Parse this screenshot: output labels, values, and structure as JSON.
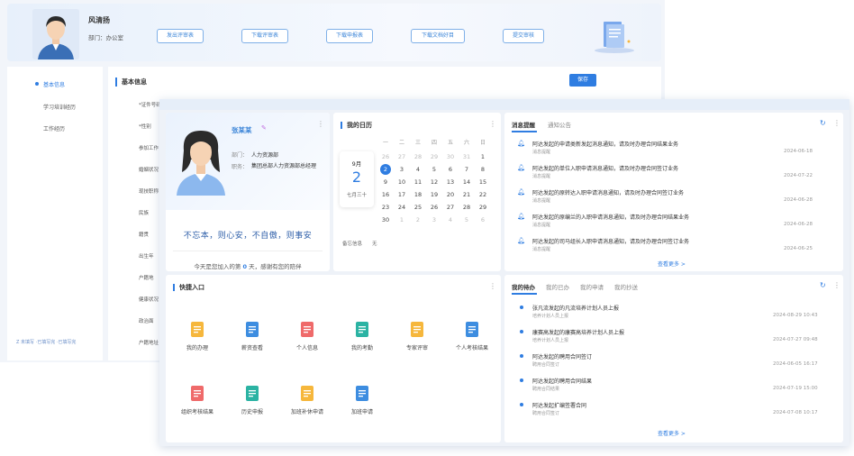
{
  "back": {
    "user_name": "风清扬",
    "dept": "部门：办公室",
    "buttons": [
      "发出评审表",
      "下载评审表",
      "下载申报表",
      "下载文档好目",
      "提交审核"
    ],
    "sidebar_items": [
      "基本信息",
      "学习培训经历",
      "工作经历"
    ],
    "sidebar_footer": "Z 未填写  ·已填写完  ·已填写完",
    "main_title": "基本信息",
    "save_label": "保存",
    "fields": [
      "*证件号码",
      "*性别",
      "参加工作",
      "婚姻状况",
      "现技职称",
      "民族",
      "籍贯",
      "出生年",
      "户籍地",
      "健康状况",
      "政治面",
      "户籍地址"
    ]
  },
  "profile": {
    "name": "张某某",
    "dept_label": "部门：",
    "dept": "人力资源部",
    "role_label": "职务：",
    "role": "集团总部人力资源部总经理",
    "motto": "不忘本，则心安，不自傲，则事安",
    "join_prefix": "今天是您加入的第",
    "join_days": "0",
    "join_suffix": "天，感谢有您的陪伴"
  },
  "schedule": {
    "title": "我的日历",
    "month": "9月",
    "day": "2",
    "lunar": "七月三十",
    "weekdays": [
      "一",
      "二",
      "三",
      "四",
      "五",
      "六",
      "日"
    ],
    "weeks": [
      [
        "26",
        "27",
        "28",
        "29",
        "30",
        "31",
        "1"
      ],
      [
        "2",
        "3",
        "4",
        "5",
        "6",
        "7",
        "8"
      ],
      [
        "9",
        "10",
        "11",
        "12",
        "13",
        "14",
        "15"
      ],
      [
        "16",
        "17",
        "18",
        "19",
        "20",
        "21",
        "22"
      ],
      [
        "23",
        "24",
        "25",
        "26",
        "27",
        "28",
        "29"
      ],
      [
        "30",
        "1",
        "2",
        "3",
        "4",
        "5",
        "6"
      ]
    ],
    "schedule_label": "备忘信息",
    "schedule_value": "无"
  },
  "messages": {
    "tabs": [
      "消息提醒",
      "通知公告"
    ],
    "items": [
      {
        "title": "阿达发起的申请类新发起消息通知，请及时办理合同结果业务",
        "sub": "消息提醒",
        "date": "2024-06-18"
      },
      {
        "title": "阿达发起的单位入职申请消息通知，请及时办理合同签订业务",
        "sub": "消息提醒",
        "date": "2024-07-22"
      },
      {
        "title": "阿达发起的原转达入职申请消息通知，请及时办理合同签订业务",
        "sub": "消息提醒",
        "date": "2024-06-28"
      },
      {
        "title": "阿达发起的原编兰的入职申请消息通知，请及时办理合同结果业务",
        "sub": "消息提醒",
        "date": "2024-06-28"
      },
      {
        "title": "阿达发起的司马组长入职申请消息通知，请及时办理合同签订业务",
        "sub": "消息提醒",
        "date": "2024-06-25"
      }
    ],
    "see_more": "查看更多 >"
  },
  "quick": {
    "title": "快捷入口",
    "items": [
      {
        "label": "我的办理",
        "color": "#f6b73c"
      },
      {
        "label": "薪资查看",
        "color": "#3d8de0"
      },
      {
        "label": "个人信息",
        "color": "#ef6a6a"
      },
      {
        "label": "我的考勤",
        "color": "#2bb3a3"
      },
      {
        "label": "专家评审",
        "color": "#f6b73c"
      },
      {
        "label": "个人考核结果",
        "color": "#3d8de0"
      },
      {
        "label": "组织考核结果",
        "color": "#ef6a6a"
      },
      {
        "label": "历史申报",
        "color": "#2bb3a3"
      },
      {
        "label": "加班补休申请",
        "color": "#f6b73c"
      },
      {
        "label": "加班申请",
        "color": "#3d8de0"
      }
    ]
  },
  "todo": {
    "tabs": [
      "我的待办",
      "我的已办",
      "我的申请",
      "我的抄送"
    ],
    "items": [
      {
        "title": "张凡流发起的凡流培养计划人员上报",
        "sub": "培养计划人员上报",
        "date": "2024-08-29 10:43"
      },
      {
        "title": "康赛高发起的康赛高培养计划人员上报",
        "sub": "培养计划人员上报",
        "date": "2024-07-27 09:48"
      },
      {
        "title": "阿达发起的聘用合同签订",
        "sub": "聘用合同签订",
        "date": "2024-06-05 16:17"
      },
      {
        "title": "阿达发起的聘用合同结果",
        "sub": "聘用合同结果",
        "date": "2024-07-19 15:00"
      },
      {
        "title": "阿达发起扩编签署合同",
        "sub": "聘用合同签订",
        "date": "2024-07-08 10:17"
      }
    ],
    "see_more": "查看更多 >"
  }
}
